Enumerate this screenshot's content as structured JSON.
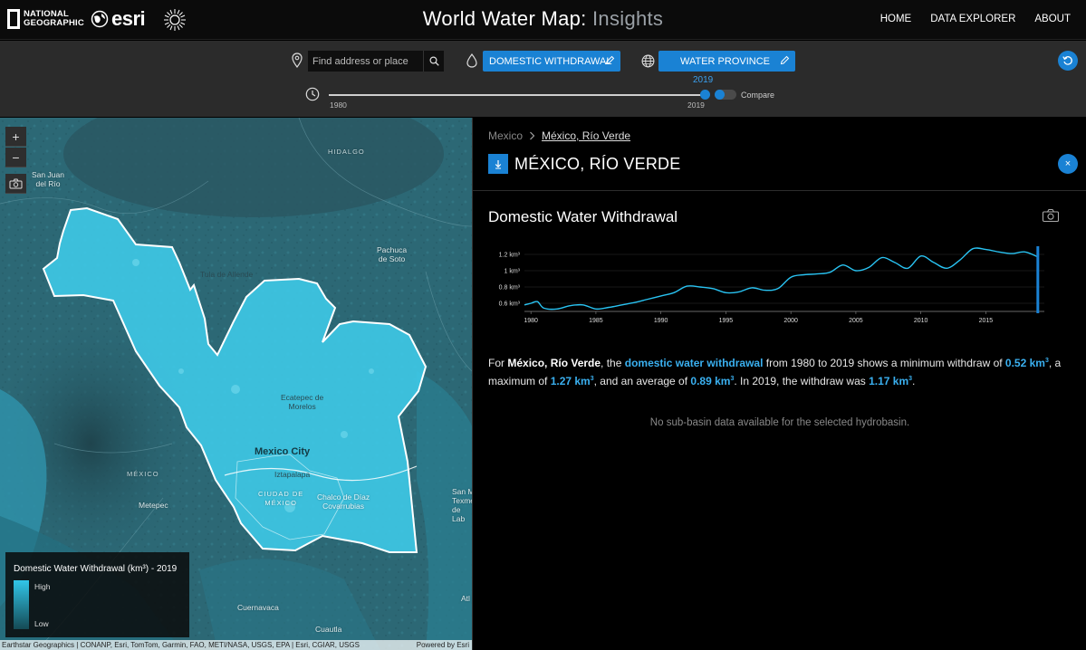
{
  "header": {
    "ng_line1": "NATIONAL",
    "ng_line2": "GEOGRAPHIC",
    "esri_label": "esri",
    "title_main": "World Water Map:",
    "title_accent": "Insights",
    "nav": [
      "HOME",
      "DATA EXPLORER",
      "ABOUT"
    ]
  },
  "toolbar": {
    "search_placeholder": "Find address or place",
    "indicator_label": "DOMESTIC WITHDRAWAL",
    "region_type_label": "WATER PROVINCE",
    "slider_year": "2019",
    "slider_start": "1980",
    "slider_end": "2019",
    "slider_value_fraction": 1.0,
    "compare_label": "Compare"
  },
  "map": {
    "zoom_in": "+",
    "zoom_out": "−",
    "places": {
      "hidalgo": "HIDALGO",
      "san_juan_1": "San Juan",
      "san_juan_2": "del Río",
      "tula": "Tula de Allende",
      "pachuca_1": "Pachuca",
      "pachuca_2": "de Soto",
      "ecatepec_1": "Ecatepec de",
      "ecatepec_2": "Morelos",
      "mexico_city": "Mexico City",
      "iztapalapa": "Iztapalapa",
      "ciudad_1": "CIUDAD DE",
      "ciudad_2": "MÉXICO",
      "chalco_1": "Chalco de Díaz",
      "chalco_2": "Covarrubias",
      "mexico_state": "MÉXICO",
      "metepec": "Metepec",
      "cuernavaca": "Cuernavaca",
      "cuautla": "Cuautla",
      "san_m_1": "San M",
      "san_m_2": "Texme",
      "san_m_3": "de Lab",
      "atl": "Atl"
    },
    "legend": {
      "title": "Domestic Water Withdrawal (km³) - 2019",
      "high": "High",
      "low": "Low"
    },
    "attribution": "Earthstar Geographics | CONANP, Esri, TomTom, Garmin, FAO, METI/NASA, USGS, EPA | Esri, CGIAR, USGS",
    "powered_by": "Powered by Esri"
  },
  "panel": {
    "breadcrumb_parent": "Mexico",
    "breadcrumb_current": "México, Río Verde",
    "region_title": "MÉXICO, RÍO VERDE",
    "close_label": "×",
    "chart_title": "Domestic Water Withdrawal",
    "summary": {
      "p1": "For ",
      "region": "México, Río Verde",
      "p2": ", the ",
      "metric": "domestic water withdrawal",
      "p3": " from 1980 to 2019 shows a minimum withdraw of ",
      "min": "0.52 km",
      "p4": ", a maximum of ",
      "max": "1.27 km",
      "p5": ", and an average of ",
      "avg": "0.89 km",
      "p6": ". In 2019, the withdraw was ",
      "current": "1.17 km",
      "p7": ".",
      "sup": "3"
    },
    "no_data": "No sub-basin data available for the selected hydrobasin."
  },
  "colors": {
    "accent": "#1a82d4",
    "highlight": "#3ab0f0",
    "line": "#29c3f2"
  },
  "chart_data": {
    "type": "line",
    "title": "Domestic Water Withdrawal",
    "xlabel": "",
    "ylabel": "",
    "x_ticks": [
      "1980",
      "1985",
      "1990",
      "1995",
      "2000",
      "2005",
      "2010",
      "2015"
    ],
    "y_ticks": [
      "0.6 km³",
      "0.8 km³",
      "1 km³",
      "1.2 km³"
    ],
    "y_tick_values": [
      0.6,
      0.8,
      1.0,
      1.2
    ],
    "xlim": [
      1979.5,
      2019.5
    ],
    "ylim": [
      0.5,
      1.3
    ],
    "grid": true,
    "x": [
      1979.5,
      1980,
      1980.5,
      1981,
      1982,
      1983,
      1984,
      1985,
      1986,
      1987,
      1988,
      1989,
      1990,
      1991,
      1992,
      1993,
      1994,
      1995,
      1996,
      1997,
      1998,
      1999,
      2000,
      2001,
      2002,
      2003,
      2004,
      2005,
      2006,
      2007,
      2008,
      2009,
      2010,
      2011,
      2012,
      2013,
      2014,
      2015,
      2016,
      2017,
      2018,
      2019
    ],
    "values": [
      0.58,
      0.6,
      0.62,
      0.54,
      0.53,
      0.57,
      0.58,
      0.53,
      0.55,
      0.58,
      0.61,
      0.65,
      0.69,
      0.73,
      0.81,
      0.8,
      0.78,
      0.73,
      0.74,
      0.79,
      0.76,
      0.78,
      0.92,
      0.95,
      0.96,
      0.98,
      1.07,
      1.0,
      1.04,
      1.16,
      1.1,
      1.03,
      1.18,
      1.1,
      1.03,
      1.13,
      1.27,
      1.26,
      1.23,
      1.21,
      1.23,
      1.17
    ]
  }
}
